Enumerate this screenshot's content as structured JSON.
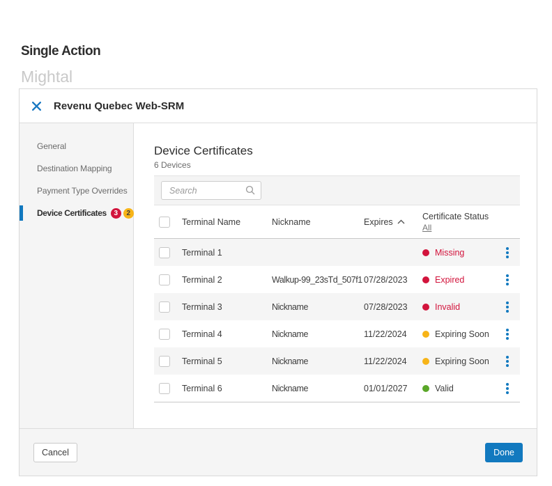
{
  "page": {
    "title": "Single Action",
    "subtitle": "Mightal"
  },
  "modal": {
    "title": "Revenu Quebec Web-SRM",
    "sidebar": {
      "items": [
        {
          "label": "General",
          "active": false,
          "badges": []
        },
        {
          "label": "Destination Mapping",
          "active": false,
          "badges": []
        },
        {
          "label": "Payment Type Overrides",
          "active": false,
          "badges": []
        },
        {
          "label": "Device Certificates",
          "active": true,
          "badges": [
            {
              "value": "3",
              "color": "red"
            },
            {
              "value": "2",
              "color": "yellow"
            }
          ]
        }
      ]
    },
    "content": {
      "title": "Device Certificates",
      "subtitle": "6 Devices",
      "search": {
        "placeholder": "Search"
      },
      "table": {
        "columns": {
          "terminal_name": "Terminal Name",
          "nickname": "Nickname",
          "expires": "Expires",
          "certificate_status": "Certificate Status"
        },
        "sort_column": "Expires",
        "sort_direction": "ascending",
        "status_filter_link": "All",
        "rows": [
          {
            "name": "Terminal 1",
            "nickname": "",
            "expires": "",
            "status": "Missing",
            "status_color": "red"
          },
          {
            "name": "Terminal 2",
            "nickname": "Walkup-99_23sTd_507f1",
            "expires": "07/28/2023",
            "status": "Expired",
            "status_color": "red"
          },
          {
            "name": "Terminal 3",
            "nickname": "Nickname",
            "expires": "07/28/2023",
            "status": "Invalid",
            "status_color": "red"
          },
          {
            "name": "Terminal 4",
            "nickname": "Nickname",
            "expires": "11/22/2024",
            "status": "Expiring Soon",
            "status_color": "yellow"
          },
          {
            "name": "Terminal 5",
            "nickname": "Nickname",
            "expires": "11/22/2024",
            "status": "Expiring Soon",
            "status_color": "yellow"
          },
          {
            "name": "Terminal 6",
            "nickname": "Nickname",
            "expires": "01/01/2027",
            "status": "Valid",
            "status_color": "green"
          }
        ]
      }
    },
    "footer": {
      "cancel_label": "Cancel",
      "done_label": "Done"
    }
  },
  "colors": {
    "accent_blue": "#1279bf",
    "status_red": "#d2143c",
    "status_yellow": "#f7b418",
    "status_green": "#5aa728"
  }
}
